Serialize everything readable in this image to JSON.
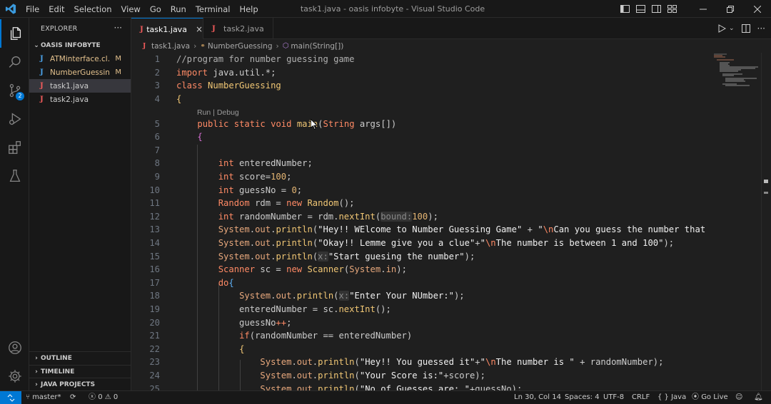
{
  "window": {
    "title": "task1.java - oasis infobyte - Visual Studio Code",
    "menu": [
      "File",
      "Edit",
      "Selection",
      "View",
      "Go",
      "Run",
      "Terminal",
      "Help"
    ]
  },
  "activity_bar": {
    "items": [
      "explorer-icon",
      "search-icon",
      "source-control-icon",
      "run-debug-icon",
      "extensions-icon",
      "testing-icon"
    ],
    "source_control_badge": "2",
    "bottom": [
      "accounts-icon",
      "manage-gear-icon"
    ]
  },
  "sidebar": {
    "title": "EXPLORER",
    "more": "···",
    "folder": "OASIS INFOBYTE",
    "files": [
      {
        "name": "ATMinterface.cl...",
        "status": "M",
        "icon_color": "blue"
      },
      {
        "name": "NumberGuessin...",
        "status": "M",
        "icon_color": "blue"
      },
      {
        "name": "task1.java",
        "status": "",
        "icon_color": "red"
      },
      {
        "name": "task2.java",
        "status": "",
        "icon_color": "red"
      }
    ],
    "sections": [
      "OUTLINE",
      "TIMELINE",
      "JAVA PROJECTS"
    ]
  },
  "tabs": [
    {
      "label": "task1.java",
      "active": true,
      "close": "×"
    },
    {
      "label": "task2.java",
      "active": false
    }
  ],
  "breadcrumb": {
    "file": "task1.java",
    "class": "NumberGuessing",
    "method": "main(String[])"
  },
  "editor": {
    "codelens": "Run | Debug",
    "line_numbers": [
      "1",
      "2",
      "3",
      "4",
      "5",
      "6",
      "7",
      "8",
      "9",
      "10",
      "11",
      "12",
      "13",
      "14",
      "15",
      "16",
      "17",
      "18",
      "19",
      "20",
      "21",
      "22",
      "23",
      "24",
      "25"
    ]
  },
  "status_bar": {
    "branch": "master*",
    "problems": "0",
    "warnings": "0",
    "position": "Ln 30, Col 14",
    "spaces": "Spaces: 4",
    "encoding": "UTF-8",
    "eol": "CRLF",
    "language": "Java",
    "golive": "Go Live"
  },
  "colors": {
    "accent": "#0078d4",
    "keyword": "#ff8a65",
    "modified": "#e2c08d"
  }
}
